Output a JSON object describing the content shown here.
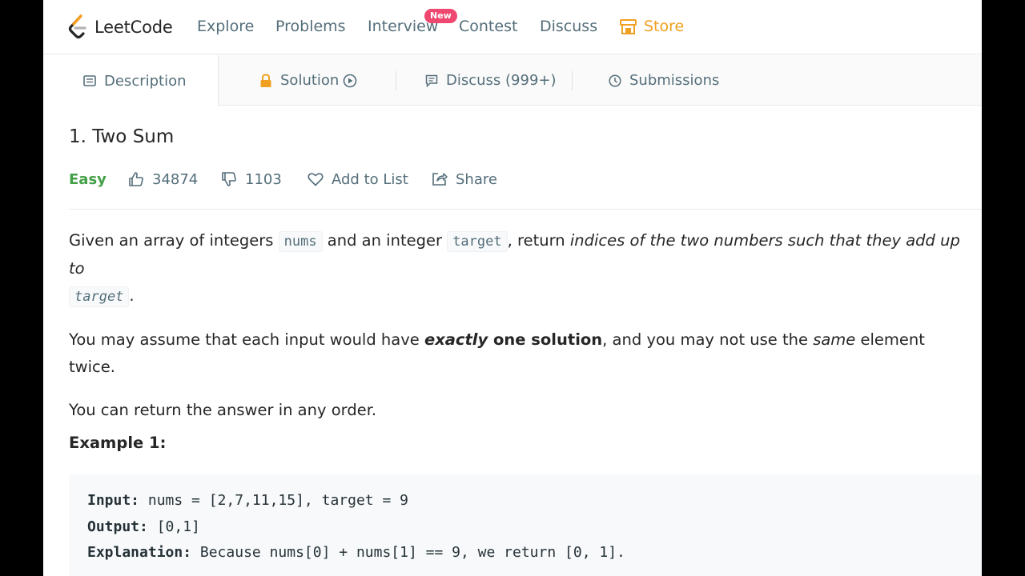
{
  "nav": {
    "logo": "LeetCode",
    "items": [
      "Explore",
      "Problems",
      "Interview",
      "Contest",
      "Discuss"
    ],
    "new_badge": "New",
    "store": "Store"
  },
  "tabs": {
    "description": "Description",
    "solution": "Solution",
    "discuss": "Discuss (999+)",
    "submissions": "Submissions"
  },
  "problem": {
    "title": "1. Two Sum",
    "difficulty": "Easy",
    "likes": "34874",
    "dislikes": "1103",
    "add_to_list": "Add to List",
    "share": "Share",
    "p1_a": "Given an array of integers ",
    "p1_code1": "nums",
    "p1_b": " and an integer ",
    "p1_code2": "target",
    "p1_c": ", return ",
    "p1_em": "indices of the two numbers such that they add up to",
    "p1_code3": "target",
    "p1_d": ".",
    "p2_a": "You may assume that each input would have ",
    "p2_em": "exactly",
    "p2_strong": " one solution",
    "p2_b": ", and you may not use the ",
    "p2_em2": "same",
    "p2_c": " element twice.",
    "p3": "You can return the answer in any order."
  },
  "example1": {
    "title": "Example 1:",
    "input_label": "Input:",
    "input_value": " nums = [2,7,11,15], target = 9",
    "output_label": "Output:",
    "output_value": " [0,1]",
    "explanation_label": "Explanation:",
    "explanation_value": " Because nums[0] + nums[1] == 9, we return [0, 1]."
  },
  "colors": {
    "accent_store": "#f0a020",
    "difficulty_easy": "#43a047",
    "new_badge": "#ef476f",
    "nav_text": "#546e7a"
  }
}
